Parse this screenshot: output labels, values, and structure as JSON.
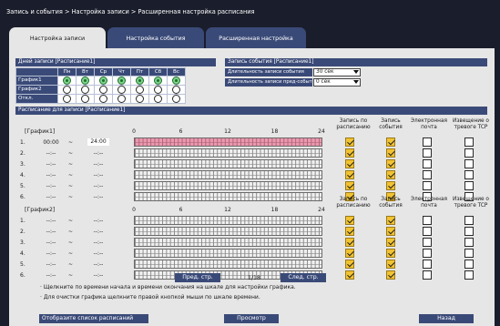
{
  "header": {
    "breadcrumb": "Запись и события > Настройка записи > Расширенная настройка расписания"
  },
  "tabs": [
    {
      "label": "Настройка записи",
      "active": true
    },
    {
      "label": "Настройка события",
      "active": false
    },
    {
      "label": "Расширенная настройка",
      "active": false
    }
  ],
  "days_section": {
    "title": "Дней записи [Расписание1]",
    "days": [
      "Пн",
      "Вт",
      "Ср",
      "Чт",
      "Пт",
      "Сб",
      "Вс"
    ],
    "rows": [
      {
        "label": "График1",
        "selected": [
          true,
          true,
          true,
          true,
          true,
          true,
          true
        ]
      },
      {
        "label": "График2",
        "selected": [
          false,
          false,
          false,
          false,
          false,
          false,
          false
        ]
      },
      {
        "label": "Откл.",
        "selected": [
          false,
          false,
          false,
          false,
          false,
          false,
          false
        ]
      }
    ]
  },
  "event_section": {
    "title": "Запись события [Расписание1]",
    "duration_label": "Длительность записи события",
    "duration_value": "30 сек",
    "pre_label": "Длительность записи пред-события",
    "pre_value": "0 сек"
  },
  "schedule_section": {
    "title": "Расписание для записи [Расписание1]"
  },
  "timeline_ticks": [
    "0",
    "6",
    "12",
    "18",
    "24"
  ],
  "column_headers": {
    "schedule_rec": "Запись по расписанию",
    "event_rec": "Запись события",
    "email": "Электронная почта",
    "tcp": "Извещение о тревоге TCP"
  },
  "graph1": {
    "label": "[График1]",
    "rows": [
      {
        "n": "1.",
        "start": "00:00",
        "sep": "~",
        "end": "24:00",
        "active": true
      },
      {
        "n": "2.",
        "start": "--:--",
        "sep": "~",
        "end": "--:--",
        "active": false
      },
      {
        "n": "3.",
        "start": "--:--",
        "sep": "~",
        "end": "--:--",
        "active": false
      },
      {
        "n": "4.",
        "start": "--:--",
        "sep": "~",
        "end": "--:--",
        "active": false
      },
      {
        "n": "5.",
        "start": "--:--",
        "sep": "~",
        "end": "--:--",
        "active": false
      },
      {
        "n": "6.",
        "start": "--:--",
        "sep": "~",
        "end": "--:--",
        "active": false
      }
    ],
    "checks": [
      [
        true,
        true,
        false,
        false
      ],
      [
        true,
        true,
        false,
        false
      ],
      [
        true,
        true,
        false,
        false
      ],
      [
        true,
        true,
        false,
        false
      ],
      [
        true,
        true,
        false,
        false
      ],
      [
        true,
        true,
        false,
        false
      ]
    ]
  },
  "graph2": {
    "label": "[График2]",
    "rows": [
      {
        "n": "1.",
        "start": "--:--",
        "sep": "~",
        "end": "--:--",
        "active": false
      },
      {
        "n": "2.",
        "start": "--:--",
        "sep": "~",
        "end": "--:--",
        "active": false
      },
      {
        "n": "3.",
        "start": "--:--",
        "sep": "~",
        "end": "--:--",
        "active": false
      },
      {
        "n": "4.",
        "start": "--:--",
        "sep": "~",
        "end": "--:--",
        "active": false
      },
      {
        "n": "5.",
        "start": "--:--",
        "sep": "~",
        "end": "--:--",
        "active": false
      },
      {
        "n": "6.",
        "start": "--:--",
        "sep": "~",
        "end": "--:--",
        "active": false
      }
    ],
    "checks": [
      [
        true,
        true,
        false,
        false
      ],
      [
        true,
        true,
        false,
        false
      ],
      [
        true,
        true,
        false,
        false
      ],
      [
        true,
        true,
        false,
        false
      ],
      [
        true,
        true,
        false,
        false
      ],
      [
        true,
        true,
        false,
        false
      ]
    ]
  },
  "pager": {
    "prev": "Пред. стр.",
    "page": "1/18",
    "next": "След. стр."
  },
  "notes": [
    "· Щелкните по времени начала и времени окончания на шкале для настройки графика.",
    "· Для очистки графика щелкните правой кнопкой мыши по шкале времени."
  ],
  "footer": {
    "list_label": "Отобразите список расписаний",
    "view_button": "Просмотр",
    "back_button": "Назад"
  },
  "colors": {
    "header": "#1a1d2b",
    "bar": "#3a4a78",
    "active_bar": "#e89aae",
    "check": "#f1c232",
    "radio": "#7fd48c"
  }
}
